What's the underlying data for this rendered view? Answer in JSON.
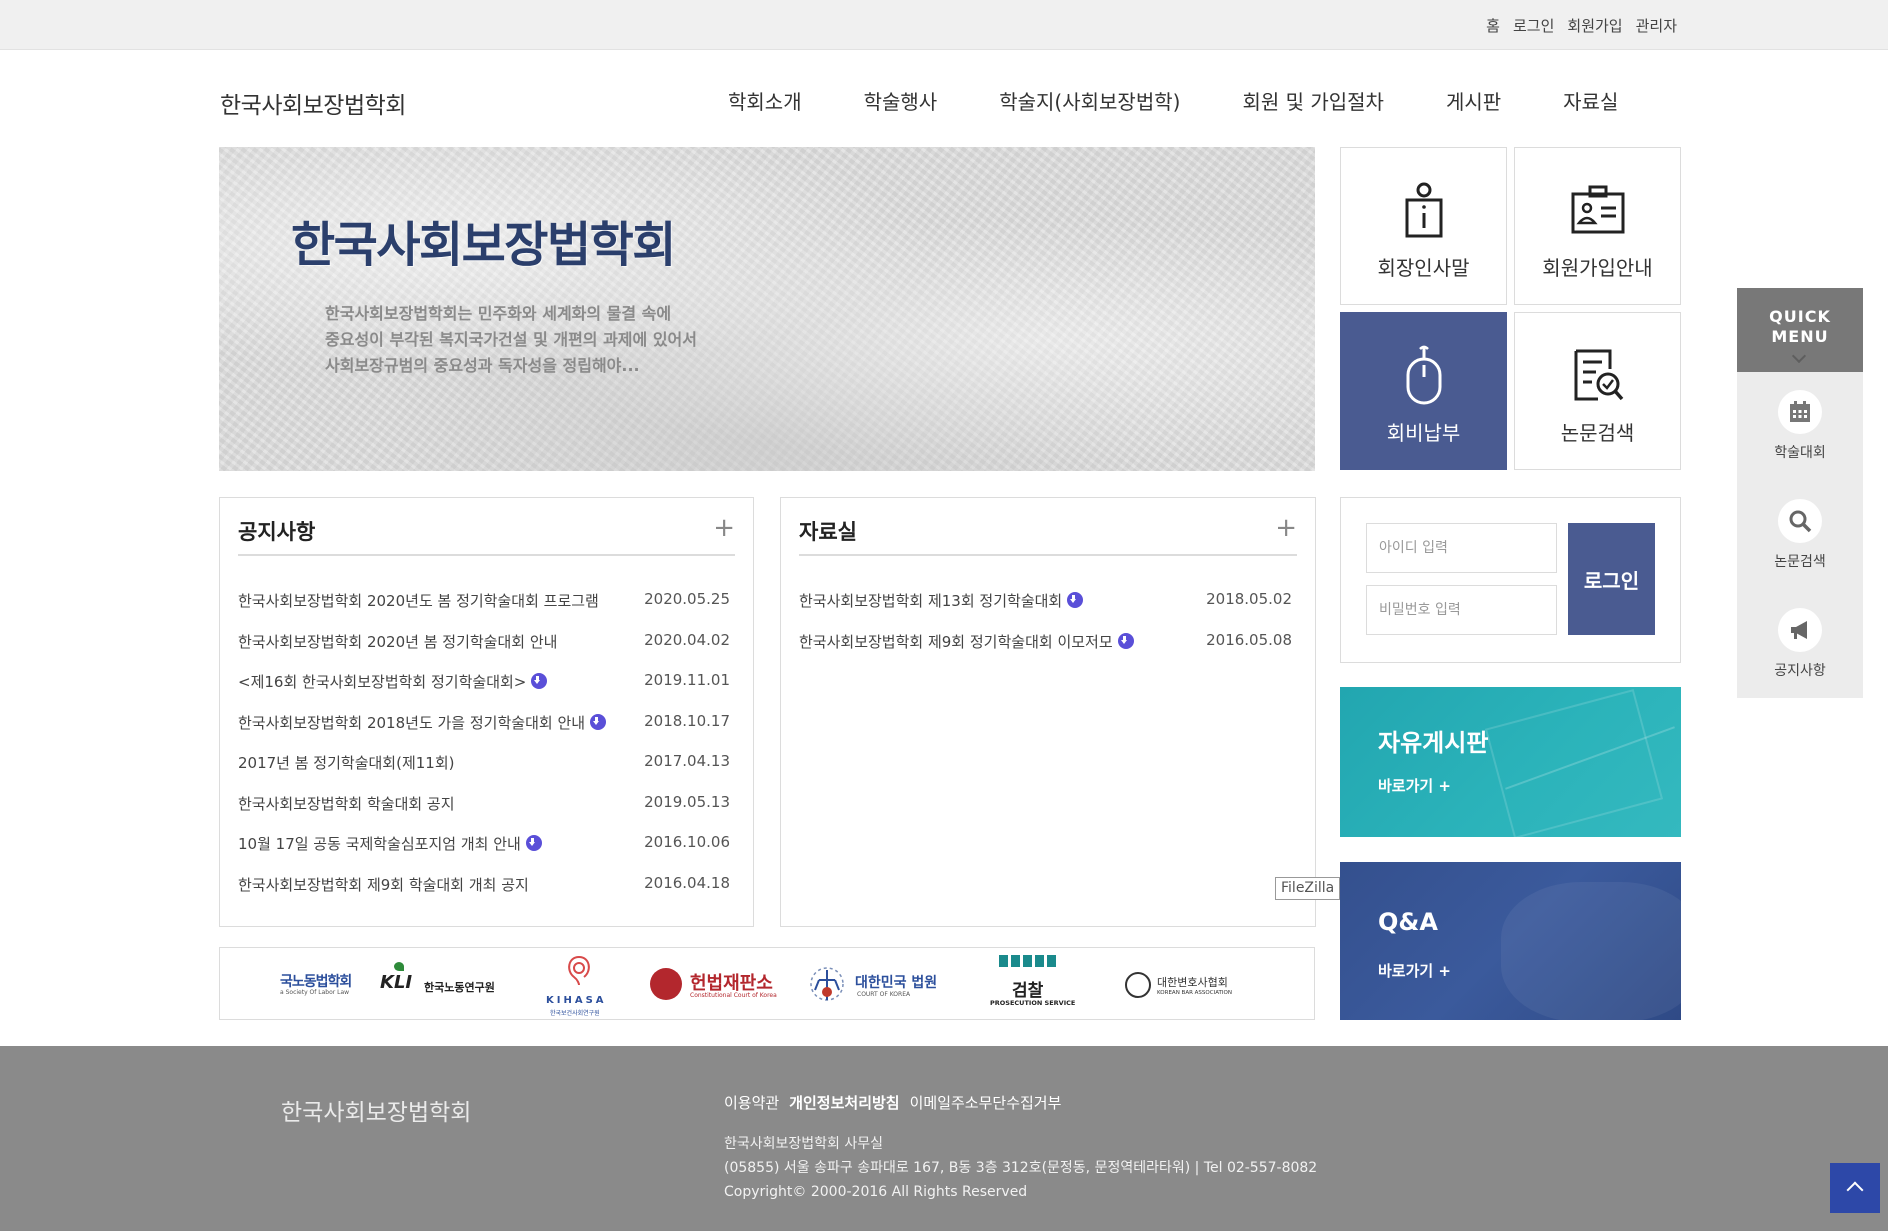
{
  "util_links": [
    "홈",
    "로그인",
    "회원가입",
    "관리자"
  ],
  "site_name": "한국사회보장법학회",
  "nav": [
    "학회소개",
    "학술행사",
    "학술지(사회보장법학)",
    "회원 및 가입절차",
    "게시판",
    "자료실"
  ],
  "hero": {
    "title": "한국사회보장법학회",
    "desc": [
      "한국사회보장법학회는 민주화와 세계화의 물결 속에",
      "중요성이 부각된 복지국가건설 및 개편의 과제에 있어서",
      "사회보장규범의 중요성과 독자성을 정립해야..."
    ]
  },
  "tiles": [
    {
      "label": "회장인사말",
      "icon": "person-info-icon"
    },
    {
      "label": "회원가입안내",
      "icon": "id-card-icon"
    },
    {
      "label": "회비납부",
      "icon": "mouse-icon"
    },
    {
      "label": "논문검색",
      "icon": "document-search-icon"
    }
  ],
  "notice": {
    "title": "공지사항",
    "more": "+",
    "items": [
      {
        "title": "한국사회보장법학회 2020년도 봄 정기학술대회 프로그램",
        "date": "2020.05.25",
        "attach": false
      },
      {
        "title": "한국사회보장법학회 2020년 봄 정기학술대회 안내",
        "date": "2020.04.02",
        "attach": false
      },
      {
        "title": "<제16회 한국사회보장법학회 정기학술대회>",
        "date": "2019.11.01",
        "attach": true
      },
      {
        "title": "한국사회보장법학회 2018년도 가을 정기학술대회 안내",
        "date": "2018.10.17",
        "attach": true
      },
      {
        "title": "2017년 봄 정기학술대회(제11회)",
        "date": "2017.04.13",
        "attach": false
      },
      {
        "title": "한국사회보장법학회 학술대회 공지",
        "date": "2019.05.13",
        "attach": false
      },
      {
        "title": "10월 17일 공동 국제학술심포지엄 개최 안내",
        "date": "2016.10.06",
        "attach": true
      },
      {
        "title": "한국사회보장법학회 제9회 학술대회 개최 공지",
        "date": "2016.04.18",
        "attach": false
      }
    ]
  },
  "archive": {
    "title": "자료실",
    "more": "+",
    "items": [
      {
        "title": "한국사회보장법학회 제13회 정기학술대회",
        "date": "2018.05.02",
        "attach": true
      },
      {
        "title": "한국사회보장법학회 제9회 정기학술대회 이모저모",
        "date": "2016.05.08",
        "attach": true
      }
    ]
  },
  "login": {
    "id_placeholder": "아이디 입력",
    "pw_placeholder": "비밀번호 입력",
    "button": "로그인"
  },
  "banners": {
    "free": {
      "title": "자유게시판",
      "go": "바로가기 +"
    },
    "qa": {
      "title": "Q&A",
      "go": "바로가기 +"
    }
  },
  "tooltip": "FileZilla",
  "partners": {
    "labor_law": {
      "main": "국노동법학회",
      "sub": "a Society Of Labor Law"
    },
    "kli": {
      "mark": "KLI",
      "name": "한국노동연구원"
    },
    "kihasa": {
      "mark": "KIHASA",
      "name": "한국보건사회연구원"
    },
    "court_const": {
      "name": "헌법재판소",
      "sub": "Constitutional Court of Korea"
    },
    "supreme_court": {
      "name": "대한민국 법원",
      "sub": "COURT OF KOREA"
    },
    "prosecution": {
      "name": "검찰",
      "sub": "PROSECUTION SERVICE"
    },
    "bar": {
      "name": "대한변호사협회",
      "sub": "KOREAN BAR ASSOCIATION"
    }
  },
  "quick_menu": {
    "header_line1": "QUICK",
    "header_line2": "MENU",
    "items": [
      {
        "label": "학술대회",
        "icon": "calendar-icon"
      },
      {
        "label": "논문검색",
        "icon": "search-icon"
      },
      {
        "label": "공지사항",
        "icon": "megaphone-icon"
      }
    ]
  },
  "footer": {
    "logo": "한국사회보장법학회",
    "links": [
      "이용약관",
      "개인정보처리방침",
      "이메일주소무단수집거부"
    ],
    "office": "한국사회보장법학회 사무실",
    "address": "(05855) 서울 송파구 송파대로 167, B동 3층 312호(문정동, 문정역테라타워) | Tel 02-557-8082",
    "copyright": "Copyright© 2000-2016 All Rights Reserved"
  },
  "colors": {
    "accent": "#4a5b91",
    "teal_banner": "#2bb3ba",
    "qa_banner": "#3b5a9c",
    "footer_bg": "#8a8a8a",
    "attach_icon": "#5a4fd8"
  }
}
